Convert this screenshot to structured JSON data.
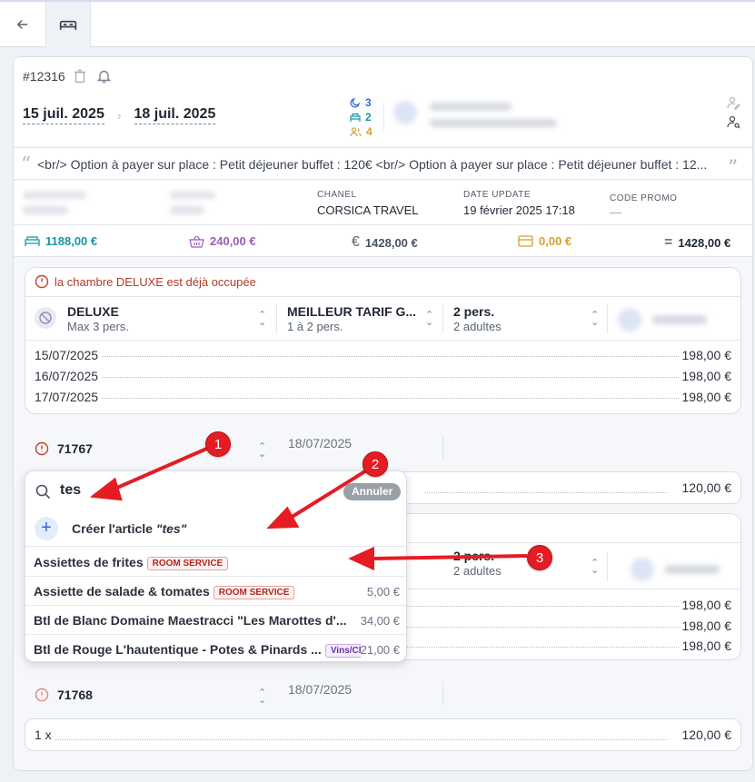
{
  "topbar": {
    "back_icon": "arrow-left-icon",
    "tab_icon": "bed-icon"
  },
  "header": {
    "reservation_number": "#12316",
    "arrival": "15 juil. 2025",
    "departure": "18 juil. 2025",
    "stats": {
      "nights": "3",
      "rooms": "2",
      "persons": "4"
    },
    "colors": {
      "nights": "#2f6ad8",
      "rooms": "#1597a8",
      "persons": "#d6a12a"
    }
  },
  "note": {
    "text": "<br/> Option à payer sur place : Petit déjeuner buffet : 120€ <br/> Option à payer sur place : Petit déjeuner buffet : 12..."
  },
  "meta": {
    "chanel_label": "CHANEL",
    "chanel_value": "CORSICA TRAVEL",
    "date_update_label": "DATE UPDATE",
    "date_update_value": "19 février 2025 17:18",
    "promo_label": "CODE PROMO",
    "promo_value": "—"
  },
  "totals": {
    "rooms": "1188,00 €",
    "extras": "240,00 €",
    "total": "1428,00 €",
    "paid": "0,00 €",
    "balance": "1428,00 €",
    "colors": {
      "rooms": "#1597a8",
      "extras": "#9b5fb5",
      "total": "#4a5260",
      "paid": "#d6a12a",
      "balance": "#1f2733"
    }
  },
  "room1": {
    "warning": "la chambre DELUXE est déjà occupée",
    "room_type": "DELUXE",
    "room_max": "Max 3 pers.",
    "rate": "MEILLEUR TARIF G...",
    "rate_sub": "1 à 2 pers.",
    "occupancy": "2 pers.",
    "occupancy_sub": "2 adultes",
    "nights": [
      {
        "date": "15/07/2025",
        "price": "198,00 €"
      },
      {
        "date": "16/07/2025",
        "price": "198,00 €"
      },
      {
        "date": "17/07/2025",
        "price": "198,00 €"
      }
    ]
  },
  "extra1": {
    "number": "71767",
    "date": "18/07/2025",
    "price": "120,00 €"
  },
  "room2": {
    "occupancy": "2 pers.",
    "occupancy_sub": "2 adultes",
    "nights": [
      {
        "price": "198,00 €"
      },
      {
        "price": "198,00 €"
      },
      {
        "price": "198,00 €"
      }
    ]
  },
  "extra2": {
    "number": "71768",
    "date": "18/07/2025",
    "qty": "1 x",
    "price": "120,00 €"
  },
  "dropdown": {
    "query": "tes",
    "cancel_label": "Annuler",
    "create_label": "Créer l'article",
    "create_query": "\"tes\"",
    "items": [
      {
        "name": "Assiettes de frites",
        "badge": "ROOM SERVICE",
        "price": ""
      },
      {
        "name": "Assiette de salade & tomates",
        "badge": "ROOM SERVICE",
        "price": "5,00 €"
      },
      {
        "name": "Btl de Blanc Domaine Maestracci \"Les Marottes d'...",
        "badge": "",
        "price": "34,00 €"
      },
      {
        "name": "Btl de Rouge L'hautentique - Potes & Pinards ...",
        "badge": "Vins/Cha",
        "price": "21,00 €"
      }
    ]
  },
  "callouts": [
    "1",
    "2",
    "3"
  ]
}
